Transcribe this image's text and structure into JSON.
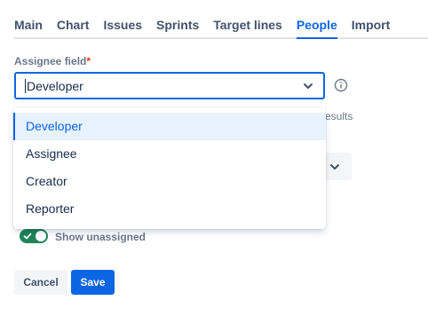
{
  "tabs": [
    {
      "label": "Main",
      "active": false
    },
    {
      "label": "Chart",
      "active": false
    },
    {
      "label": "Issues",
      "active": false
    },
    {
      "label": "Sprints",
      "active": false
    },
    {
      "label": "Target lines",
      "active": false
    },
    {
      "label": "People",
      "active": true
    },
    {
      "label": "Import",
      "active": false
    }
  ],
  "assignee_field": {
    "label": "Assignee field",
    "required_marker": "*",
    "value": "Developer",
    "options": [
      "Developer",
      "Assignee",
      "Creator",
      "Reporter"
    ],
    "selected_option": "Developer"
  },
  "obscured": {
    "results_text": "esults"
  },
  "show_unassigned": {
    "label": "Show unassigned",
    "enabled": true
  },
  "actions": {
    "cancel_label": "Cancel",
    "save_label": "Save"
  },
  "icons": {
    "chevron": "chevron-down-icon",
    "info": "info-icon",
    "check": "check-icon"
  },
  "colors": {
    "accent": "#0c66e4",
    "toggle_on": "#1f845a",
    "required": "#de350b"
  }
}
